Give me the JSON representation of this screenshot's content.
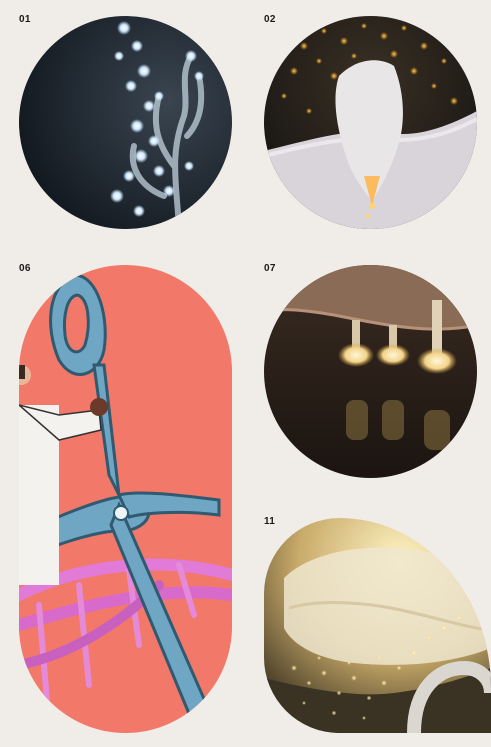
{
  "gallery": {
    "items": [
      {
        "label": "01",
        "subject": "glowing-coral-tree"
      },
      {
        "label": "02",
        "subject": "erupting-cell-particles"
      },
      {
        "label": "06",
        "subject": "scissors-dna-illustration"
      },
      {
        "label": "07",
        "subject": "glowing-bulbs-under-membrane"
      },
      {
        "label": "11",
        "subject": "glowing-membrane-particles"
      }
    ]
  },
  "colors": {
    "background": "#f0ece7",
    "label": "#1a1a1a",
    "salmon": "#f2786a",
    "scissors_blue": "#6ea6c4",
    "dna_pink": "#e27ad8"
  }
}
